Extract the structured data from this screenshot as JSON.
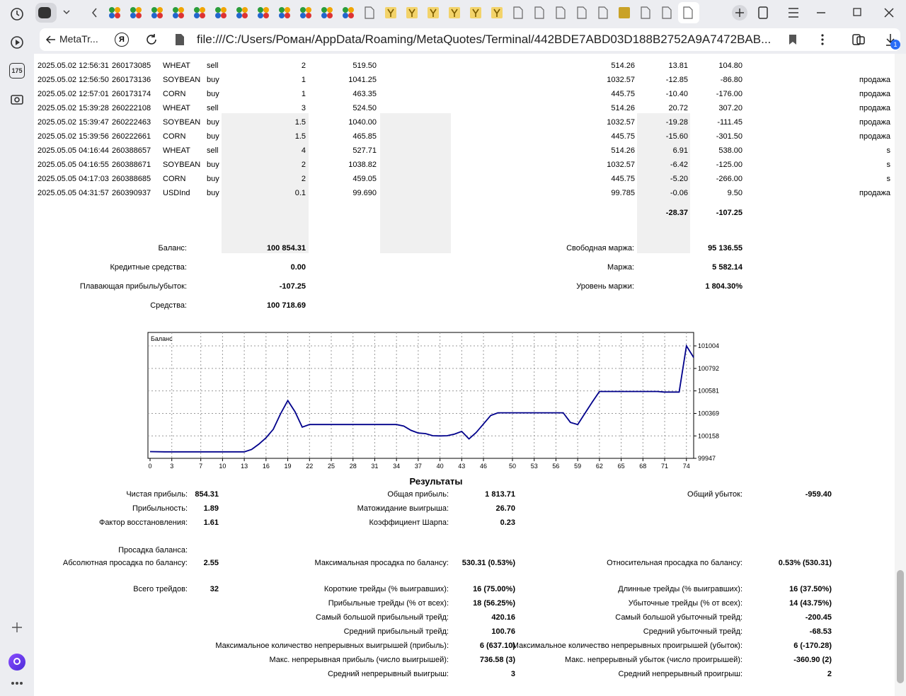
{
  "browser": {
    "sidebar_badge": "175",
    "tab_title": "MetaTr...",
    "ya_label": "Я",
    "url": "file:///C:/Users/Роман/AppData/Roaming/MetaQuotes/Terminal/442BDE7ABD03D188B2752A9A7472BAB...",
    "downloads_count": "1"
  },
  "trades": [
    {
      "time": "2025.05.02 12:56:31",
      "ticket": "260173085",
      "symbol": "WHEAT",
      "type": "sell",
      "volume": "2",
      "price": "519.50",
      "cur": "514.26",
      "swap": "13.81",
      "profit": "104.80",
      "comment": ""
    },
    {
      "time": "2025.05.02 12:56:50",
      "ticket": "260173136",
      "symbol": "SOYBEAN",
      "type": "buy",
      "volume": "1",
      "price": "1041.25",
      "cur": "1032.57",
      "swap": "-12.85",
      "profit": "-86.80",
      "comment": "продажа"
    },
    {
      "time": "2025.05.02 12:57:01",
      "ticket": "260173174",
      "symbol": "CORN",
      "type": "buy",
      "volume": "1",
      "price": "463.35",
      "cur": "445.75",
      "swap": "-10.40",
      "profit": "-176.00",
      "comment": "продажа"
    },
    {
      "time": "2025.05.02 15:39:28",
      "ticket": "260222108",
      "symbol": "WHEAT",
      "type": "sell",
      "volume": "3",
      "price": "524.50",
      "cur": "514.26",
      "swap": "20.72",
      "profit": "307.20",
      "comment": "продажа"
    },
    {
      "time": "2025.05.02 15:39:47",
      "ticket": "260222463",
      "symbol": "SOYBEAN",
      "type": "buy",
      "volume": "1.5",
      "price": "1040.00",
      "cur": "1032.57",
      "swap": "-19.28",
      "profit": "-111.45",
      "comment": "продажа"
    },
    {
      "time": "2025.05.02 15:39:56",
      "ticket": "260222661",
      "symbol": "CORN",
      "type": "buy",
      "volume": "1.5",
      "price": "465.85",
      "cur": "445.75",
      "swap": "-15.60",
      "profit": "-301.50",
      "comment": "продажа"
    },
    {
      "time": "2025.05.05 04:16:44",
      "ticket": "260388657",
      "symbol": "WHEAT",
      "type": "sell",
      "volume": "4",
      "price": "527.71",
      "cur": "514.26",
      "swap": "6.91",
      "profit": "538.00",
      "comment": "s"
    },
    {
      "time": "2025.05.05 04:16:55",
      "ticket": "260388671",
      "symbol": "SOYBEAN",
      "type": "buy",
      "volume": "2",
      "price": "1038.82",
      "cur": "1032.57",
      "swap": "-6.42",
      "profit": "-125.00",
      "comment": "s"
    },
    {
      "time": "2025.05.05 04:17:03",
      "ticket": "260388685",
      "symbol": "CORN",
      "type": "buy",
      "volume": "2",
      "price": "459.05",
      "cur": "445.75",
      "swap": "-5.20",
      "profit": "-266.00",
      "comment": "s"
    },
    {
      "time": "2025.05.05 04:31:57",
      "ticket": "260390937",
      "symbol": "USDInd",
      "type": "buy",
      "volume": "0.1",
      "price": "99.690",
      "cur": "99.785",
      "swap": "-0.06",
      "profit": "9.50",
      "comment": "продажа"
    }
  ],
  "totals": {
    "swap": "-28.37",
    "profit": "-107.25"
  },
  "account": {
    "balance_label": "Баланс:",
    "balance": "100 854.31",
    "credit_label": "Кредитные средства:",
    "credit": "0.00",
    "floating_label": "Плавающая прибыль/убыток:",
    "floating": "-107.25",
    "equity_label": "Средства:",
    "equity": "100 718.69",
    "free_margin_label": "Свободная маржа:",
    "free_margin": "95 136.55",
    "margin_label": "Маржа:",
    "margin": "5 582.14",
    "margin_level_label": "Уровень маржи:",
    "margin_level": "1 804.30%"
  },
  "chart_data": {
    "type": "line",
    "title": "Баланс",
    "x_ticks": [
      "0",
      "3",
      "7",
      "10",
      "13",
      "16",
      "19",
      "22",
      "25",
      "28",
      "31",
      "34",
      "37",
      "40",
      "43",
      "46",
      "50",
      "53",
      "56",
      "59",
      "62",
      "65",
      "68",
      "71",
      "74"
    ],
    "y_ticks": [
      "101004",
      "100792",
      "100581",
      "100369",
      "100158",
      "99947"
    ],
    "ylim": [
      99947,
      101004
    ],
    "xlim": [
      0,
      75
    ],
    "grid": true,
    "line_color": "#00008b",
    "x": [
      0,
      2,
      4,
      6,
      8,
      10,
      12,
      13,
      14,
      15,
      16,
      17,
      18,
      19,
      20,
      21,
      22,
      24,
      26,
      28,
      30,
      32,
      34,
      35,
      36,
      37,
      38,
      39,
      40,
      41,
      42,
      43,
      44,
      45,
      46,
      47,
      48,
      50,
      52,
      54,
      56,
      57,
      58,
      59,
      60,
      61,
      62,
      64,
      66,
      68,
      70,
      71,
      72,
      73,
      74,
      75
    ],
    "y": [
      100010,
      100008,
      100008,
      100008,
      100008,
      100008,
      100008,
      100008,
      100030,
      100080,
      100140,
      100220,
      100365,
      100490,
      100385,
      100240,
      100265,
      100265,
      100265,
      100265,
      100265,
      100265,
      100265,
      100250,
      100210,
      100185,
      100180,
      100160,
      100158,
      100160,
      100175,
      100200,
      100130,
      100190,
      100270,
      100350,
      100375,
      100375,
      100375,
      100375,
      100375,
      100375,
      100285,
      100265,
      100370,
      100475,
      100575,
      100575,
      100575,
      100575,
      100575,
      100570,
      100570,
      100570,
      101004,
      100895
    ]
  },
  "results": {
    "title": "Результаты",
    "net_profit_label": "Чистая прибыль:",
    "net_profit": "854.31",
    "profitability_label": "Прибыльность:",
    "profitability": "1.89",
    "recovery_label": "Фактор восстановления:",
    "recovery": "1.61",
    "gross_profit_label": "Общая прибыль:",
    "gross_profit": "1 813.71",
    "expected_label": "Матожидание выигрыша:",
    "expected": "26.70",
    "sharpe_label": "Коэффициент Шарпа:",
    "sharpe": "0.23",
    "gross_loss_label": "Общий убыток:",
    "gross_loss": "-959.40",
    "drawdown_header": "Просадка баланса:",
    "abs_dd_label": "Абсолютная просадка по балансу:",
    "abs_dd": "2.55",
    "max_dd_label": "Максимальная просадка по балансу:",
    "max_dd": "530.31 (0.53%)",
    "rel_dd_label": "Относительная просадка по балансу:",
    "rel_dd": "0.53% (530.31)",
    "total_trades_label": "Всего трейдов:",
    "total_trades": "32",
    "short_label": "Короткие трейды (% выигравших):",
    "short": "16 (75.00%)",
    "profit_trades_label": "Прибыльные трейды (% от всех):",
    "profit_trades": "18 (56.25%)",
    "largest_profit_label": "Самый большой прибыльный трейд:",
    "largest_profit": "420.16",
    "avg_profit_label": "Средний прибыльный трейд:",
    "avg_profit": "100.76",
    "max_cons_wins_label": "Максимальное количество непрерывных выигрышей (прибыль):",
    "max_cons_wins": "6 (637.10)",
    "max_cons_profit_label": "Макс. непрерывная прибыль (число выигрышей):",
    "max_cons_profit": "736.58 (3)",
    "avg_cons_wins_label": "Средний непрерывный выигрыш:",
    "avg_cons_wins": "3",
    "long_label": "Длинные трейды (% выигравших):",
    "long": "16 (37.50%)",
    "loss_trades_label": "Убыточные трейды (% от всех):",
    "loss_trades": "14 (43.75%)",
    "largest_loss_label": "Самый большой убыточный трейд:",
    "largest_loss": "-200.45",
    "avg_loss_label": "Средний убыточный трейд:",
    "avg_loss": "-68.53",
    "max_cons_losses_label": "Максимальное количество непрерывных проигрышей (убыток):",
    "max_cons_losses": "6 (-170.28)",
    "max_cons_loss_label": "Макс. непрерывный убыток (число проигрышей):",
    "max_cons_loss": "-360.90 (2)",
    "avg_cons_losses_label": "Средний непрерывный проигрыш:",
    "avg_cons_losses": "2"
  }
}
